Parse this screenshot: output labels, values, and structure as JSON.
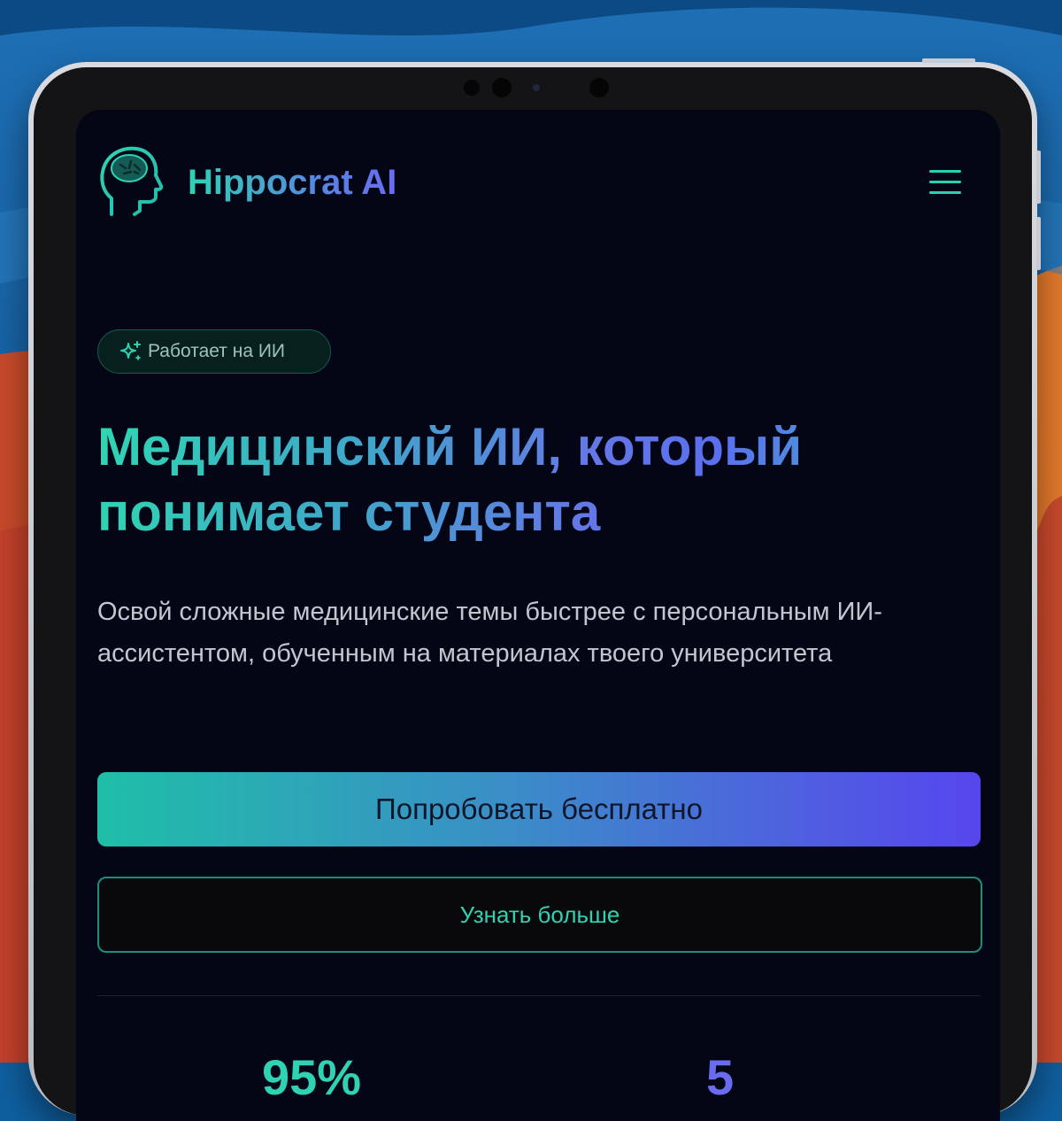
{
  "app": {
    "brand": "Hippocrat AI",
    "logo_icon": "brain-head-icon",
    "menu_icon": "hamburger-menu-icon"
  },
  "hero": {
    "badge": {
      "icon": "sparkles-icon",
      "label": "Работает на ИИ"
    },
    "headline_line1": "Медицинский ИИ, который",
    "headline_line2": "понимает студента",
    "subtitle": "Освой сложные медицинские темы быстрее с персональным ИИ-ассистентом, обученным на материалах твоего университета",
    "primary_cta": "Попробовать бесплатно",
    "secondary_cta": "Узнать больше"
  },
  "stats": [
    {
      "value": "95%"
    },
    {
      "value": "5"
    }
  ],
  "colors": {
    "accent_teal": "#2fd3b3",
    "accent_indigo": "#5646ee",
    "screen_bg": "#040616",
    "text_muted": "#c3c6cf"
  }
}
